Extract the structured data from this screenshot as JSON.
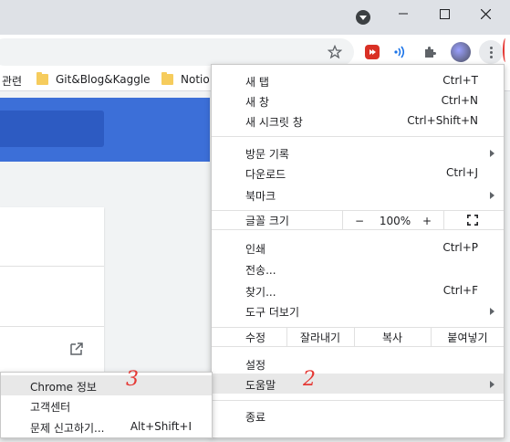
{
  "toolbar": {
    "star_icon": "star-icon",
    "extension_icons": [
      "red-media-icon",
      "wifi-signal-icon",
      "puzzle-icon"
    ],
    "profile": "avatar"
  },
  "bookmarks": {
    "partial_label": "관련",
    "items": [
      {
        "label": "Git&Blog&Kaggle",
        "icon": "folder-icon"
      },
      {
        "label": "Notio",
        "icon": "folder-icon"
      }
    ]
  },
  "menu": {
    "new_tab": {
      "label": "새 탭",
      "shortcut": "Ctrl+T"
    },
    "new_window": {
      "label": "새 창",
      "shortcut": "Ctrl+N"
    },
    "incognito": {
      "label": "새 시크릿 창",
      "shortcut": "Ctrl+Shift+N"
    },
    "history": {
      "label": "방문 기록"
    },
    "downloads": {
      "label": "다운로드",
      "shortcut": "Ctrl+J"
    },
    "bookmarks": {
      "label": "북마크"
    },
    "zoom": {
      "label": "글꼴 크기",
      "minus": "−",
      "value": "100%",
      "plus": "+"
    },
    "print": {
      "label": "인쇄",
      "shortcut": "Ctrl+P"
    },
    "cast": {
      "label": "전송..."
    },
    "find": {
      "label": "찾기...",
      "shortcut": "Ctrl+F"
    },
    "more_tools": {
      "label": "도구 더보기"
    },
    "edit": {
      "label": "수정",
      "cut": "잘라내기",
      "copy": "복사",
      "paste": "붙여넣기"
    },
    "settings": {
      "label": "설정"
    },
    "help": {
      "label": "도움말"
    },
    "exit": {
      "label": "종료"
    }
  },
  "help_submenu": {
    "about": {
      "label": "Chrome 정보"
    },
    "help_center": {
      "label": "고객센터"
    },
    "report": {
      "label": "문제 신고하기...",
      "shortcut": "Alt+Shift+I"
    }
  },
  "annotations": {
    "step2": "2",
    "step3": "3"
  },
  "colors": {
    "accent": "#3c6fd8",
    "annotation": "#e53935",
    "highlight": "#e8e8e8"
  }
}
